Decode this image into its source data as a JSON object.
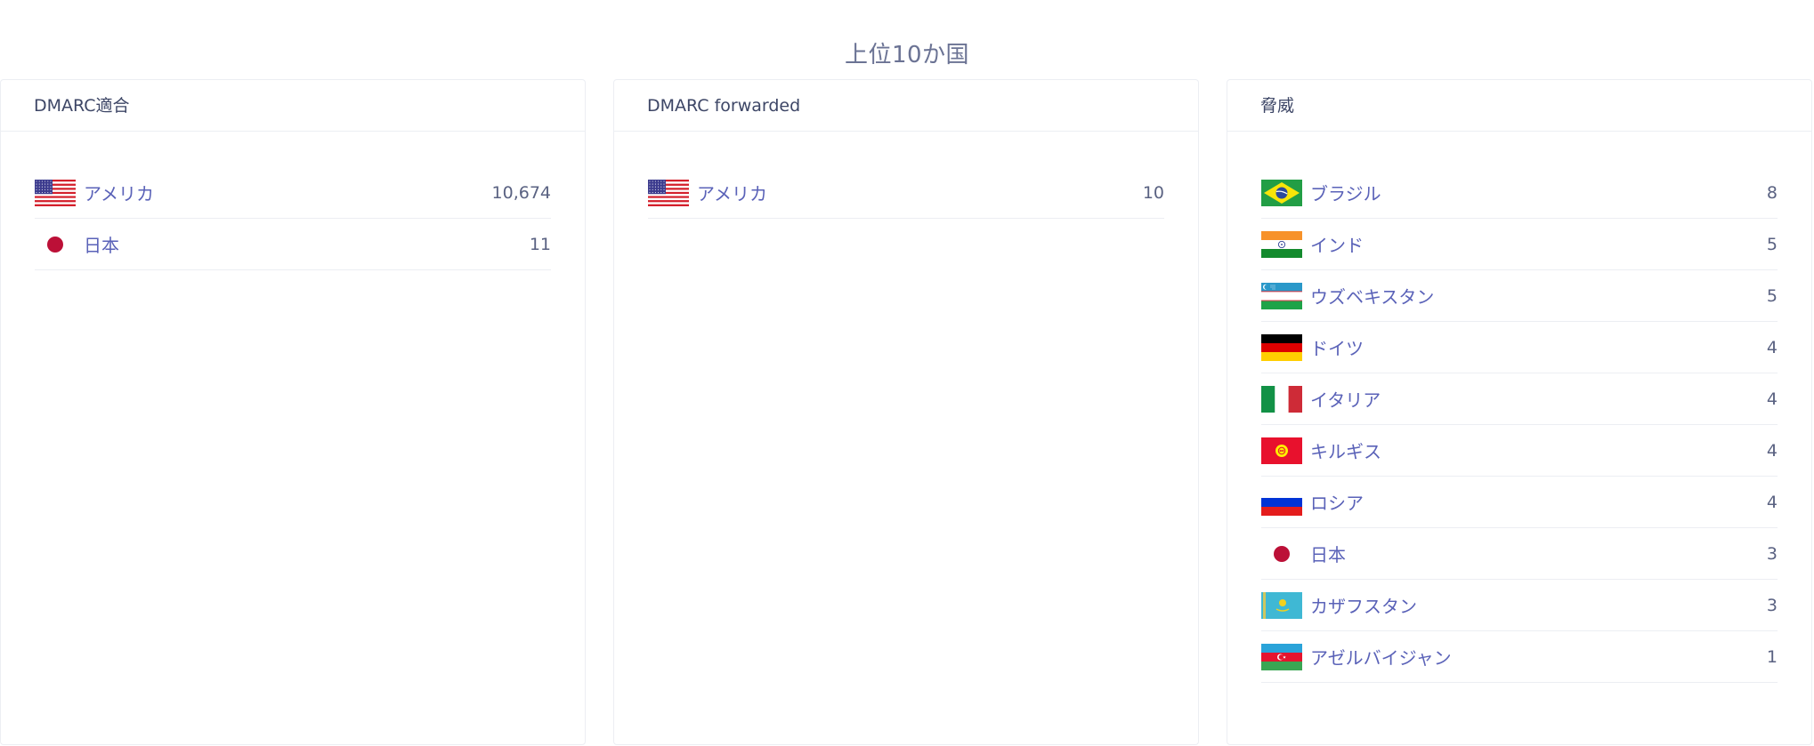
{
  "title": "上位10か国",
  "panels": [
    {
      "header": "DMARC適合",
      "rows": [
        {
          "country": "アメリカ",
          "count": "10,674",
          "flag": "us-flag-icon"
        },
        {
          "country": "日本",
          "count": "11",
          "flag": "jp-flag-icon"
        }
      ]
    },
    {
      "header": "DMARC forwarded",
      "rows": [
        {
          "country": "アメリカ",
          "count": "10",
          "flag": "us-flag-icon"
        }
      ]
    },
    {
      "header": "脅威",
      "rows": [
        {
          "country": "ブラジル",
          "count": "8",
          "flag": "br-flag-icon"
        },
        {
          "country": "インド",
          "count": "5",
          "flag": "in-flag-icon"
        },
        {
          "country": "ウズベキスタン",
          "count": "5",
          "flag": "uz-flag-icon"
        },
        {
          "country": "ドイツ",
          "count": "4",
          "flag": "de-flag-icon"
        },
        {
          "country": "イタリア",
          "count": "4",
          "flag": "it-flag-icon"
        },
        {
          "country": "キルギス",
          "count": "4",
          "flag": "kg-flag-icon"
        },
        {
          "country": "ロシア",
          "count": "4",
          "flag": "ru-flag-icon"
        },
        {
          "country": "日本",
          "count": "3",
          "flag": "jp-flag-icon"
        },
        {
          "country": "カザフスタン",
          "count": "3",
          "flag": "kz-flag-icon"
        },
        {
          "country": "アゼルバイジャン",
          "count": "1",
          "flag": "az-flag-icon"
        }
      ]
    }
  ],
  "colors": {
    "link": "#5a62b8",
    "border": "#eceef3",
    "title": "#6b7394"
  }
}
